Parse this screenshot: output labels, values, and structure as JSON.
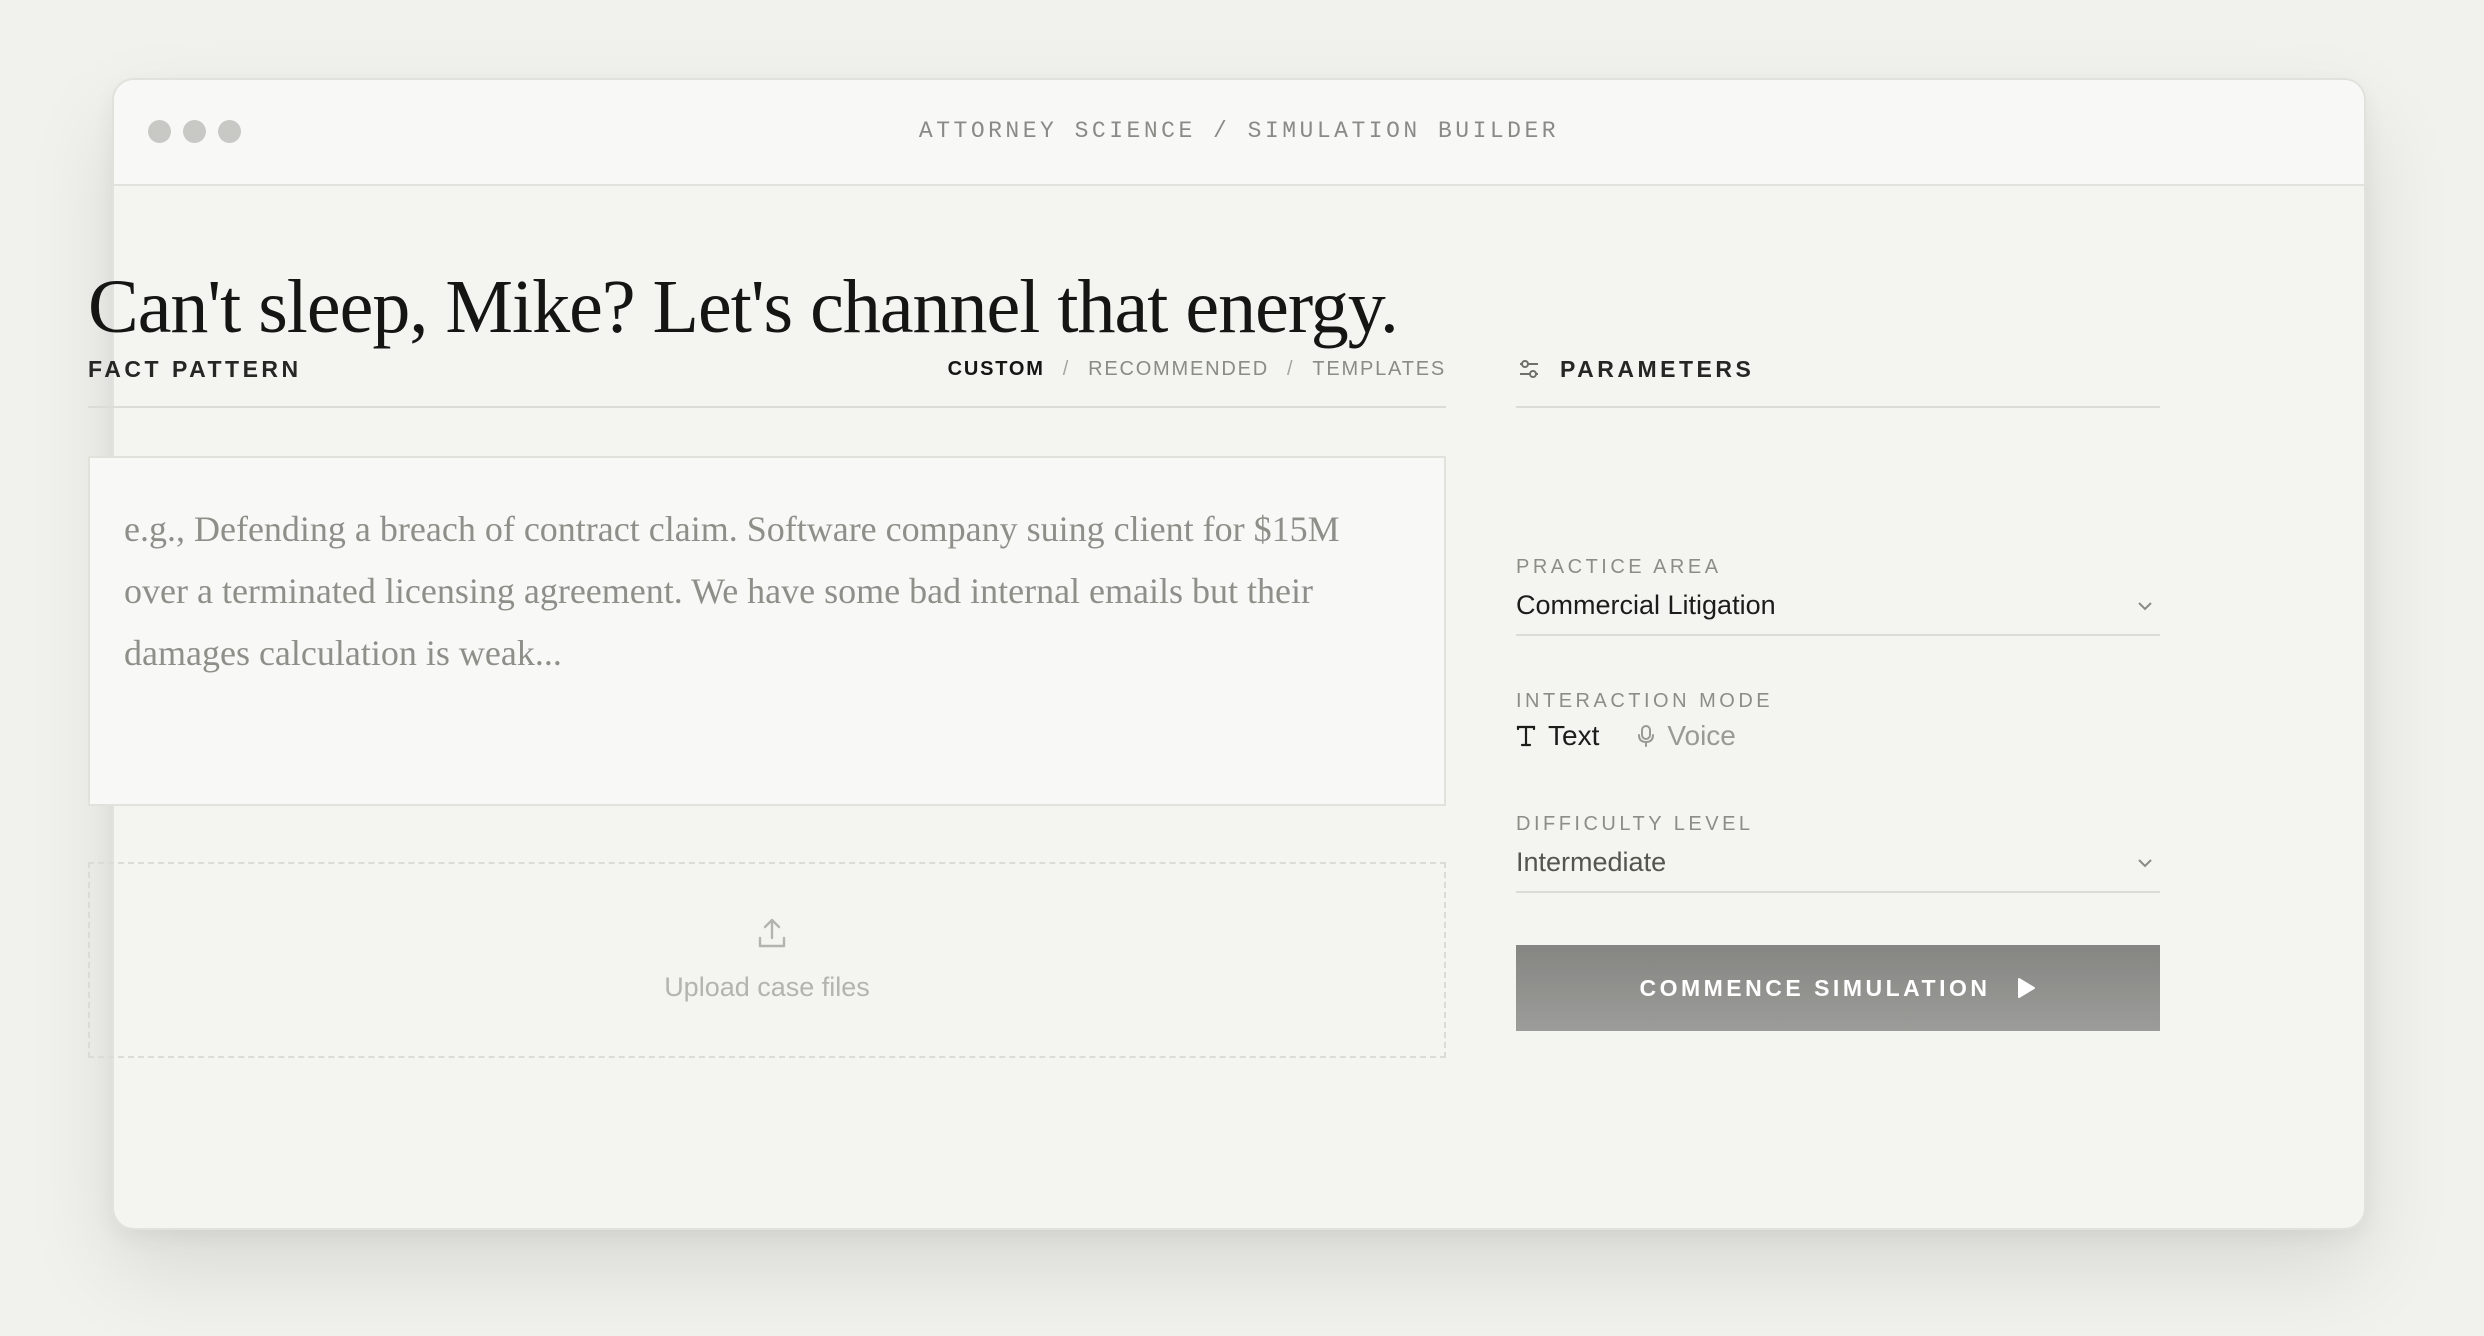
{
  "window": {
    "title": "ATTORNEY SCIENCE / SIMULATION BUILDER"
  },
  "headline": "Can't sleep, Mike? Let's channel that energy.",
  "fact_pattern": {
    "label": "FACT PATTERN",
    "tabs": [
      {
        "label": "CUSTOM",
        "active": true
      },
      {
        "label": "RECOMMENDED",
        "active": false
      },
      {
        "label": "TEMPLATES",
        "active": false
      }
    ],
    "tab_separator": "/",
    "placeholder": "e.g., Defending a breach of contract claim. Software company suing client for $15M over a terminated licensing agreement. We have some bad internal emails but their damages calculation is weak...",
    "value": ""
  },
  "upload": {
    "label": "Upload case files",
    "icon": "upload-icon"
  },
  "parameters": {
    "label": "PARAMETERS",
    "icon": "sliders-icon",
    "practice_area": {
      "label": "PRACTICE AREA",
      "value": "Commercial Litigation"
    },
    "interaction_mode": {
      "label": "INTERACTION MODE",
      "options": [
        {
          "label": "Text",
          "icon": "text-icon",
          "selected": true
        },
        {
          "label": "Voice",
          "icon": "microphone-icon",
          "selected": false
        }
      ]
    },
    "difficulty": {
      "label": "DIFFICULTY LEVEL",
      "value": "Intermediate"
    },
    "commence_label": "COMMENCE SIMULATION"
  },
  "colors": {
    "background": "#f1f1ed",
    "window": "#f4f4f0",
    "button": "#8e8e8b",
    "text": "#1c1c1a",
    "muted": "#8a8a86"
  }
}
